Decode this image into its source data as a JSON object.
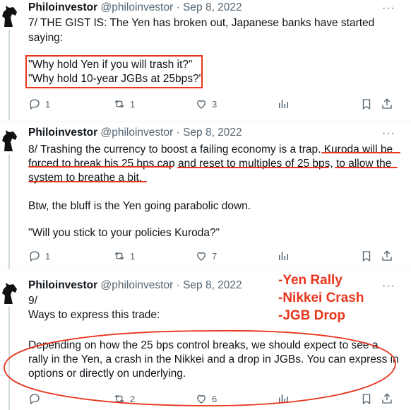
{
  "colors": {
    "accent_red": "#e8361c",
    "muted": "#536471",
    "text": "#0f1419",
    "divider": "#eff3f4"
  },
  "tweets": [
    {
      "name": "Philoinvestor",
      "handle": "@philoinvestor",
      "sep": "·",
      "date": "Sep 8, 2022",
      "more": "···",
      "lines": [
        "7/ THE GIST IS: The Yen has broken out, Japanese banks have started",
        "saying:",
        "\"Why hold Yen if you will trash it?\"",
        "\"Why hold 10-year JGBs at 25bps?\""
      ],
      "replies": "1",
      "retweets": "1",
      "likes": "3"
    },
    {
      "name": "Philoinvestor",
      "handle": "@philoinvestor",
      "sep": "·",
      "date": "Sep 8, 2022",
      "more": "···",
      "lines": [
        "8/ Trashing the currency to boost a failing economy is a trap. Kuroda will be",
        "forced to break his 25 bps cap and reset to multiples of 25 bps, to allow the",
        "system to breathe a bit.",
        "Btw, the bluff is the Yen going parabolic down.",
        "\"Will you stick to your policies Kuroda?\""
      ],
      "replies": "1",
      "retweets": "1",
      "likes": "7"
    },
    {
      "name": "Philoinvestor",
      "handle": "@philoinvestor",
      "sep": "·",
      "date": "Sep 8, 2022",
      "more": "···",
      "lines": [
        "9/",
        "Ways to express this trade:",
        "Depending on how the 25 bps control breaks, we should expect to see a",
        "rally in the Yen, a crash in the Nikkei and a drop in JGBs. You can express in",
        "options or directly on underlying."
      ],
      "replies": "",
      "retweets": "2",
      "likes": "6"
    }
  ],
  "annotation": [
    "-Yen Rally",
    "-Nikkei Crash",
    "-JGB Drop"
  ]
}
